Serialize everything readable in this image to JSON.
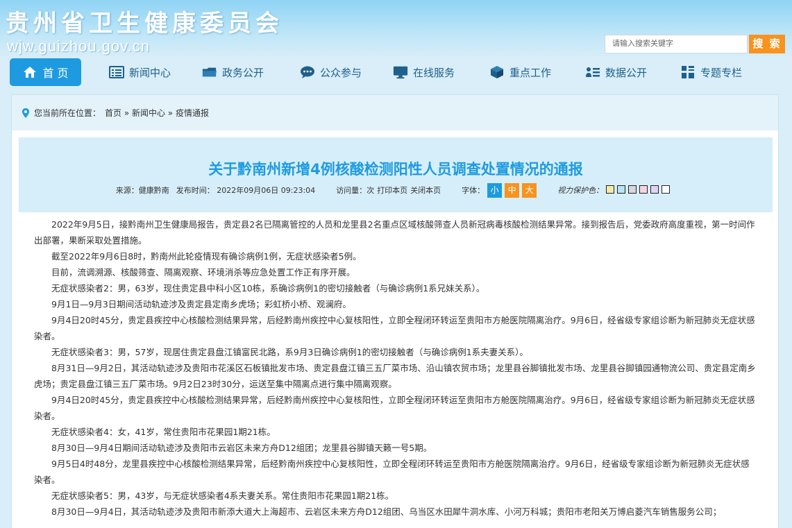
{
  "header": {
    "title": "贵州省卫生健康委员会",
    "domain": "wjw.guizhou.gov.cn",
    "search_placeholder": "请输入搜索关键字",
    "search_button": "搜 索"
  },
  "nav": {
    "items": [
      {
        "label": "首 页",
        "icon": "home-icon"
      },
      {
        "label": "新闻中心",
        "icon": "news-icon"
      },
      {
        "label": "政务公开",
        "icon": "folder-icon"
      },
      {
        "label": "公众参与",
        "icon": "chat-icon"
      },
      {
        "label": "在线服务",
        "icon": "monitor-icon"
      },
      {
        "label": "重点工作",
        "icon": "cube-icon"
      },
      {
        "label": "数据公开",
        "icon": "data-icon"
      },
      {
        "label": "专题专栏",
        "icon": "grid-icon"
      }
    ]
  },
  "breadcrumb": {
    "prefix": "您当前所在位置：",
    "path": "首页 » 新闻中心 » 疫情通报"
  },
  "article": {
    "title": "关于黔南州新增4例核酸检测阳性人员调查处置情况的通报",
    "source": "来源：健康黔南",
    "publish": "发布时间： 2022年09月06日 09:23:04",
    "visits": "访问量：次",
    "print": "打印本页",
    "close": "关闭本页",
    "font_label": "字体：",
    "font_small": "小",
    "font_mid": "中",
    "font_big": "大",
    "eye_label": "视力保护色：",
    "eye_colors": [
      "#f5e9a8",
      "#b9e3f0",
      "#d8d8d8",
      "#f7d4dc",
      "#e3d4f3",
      "#ffffff"
    ],
    "paragraphs": [
      "2022年9月5日，接黔南州卫生健康局报告，贵定县2名已隔离管控的人员和龙里县2名重点区域核酸筛查人员新冠病毒核酸检测结果异常。接到报告后，党委政府高度重视，第一时间作出部署，果断采取处置措施。",
      "截至2022年9月6日8时，黔南州此轮疫情现有确诊病例1例，无症状感染者5例。",
      "目前，流调溯源、核酸筛查、隔离观察、环境消杀等应急处置工作正有序开展。",
      "无症状感染者2：男，63岁，现住贵定县中科小区10栋，系确诊病例1的密切接触者（与确诊病例1系兄妹关系）。",
      "9月1日—9月3日期间活动轨迹涉及贵定县定南乡虎场；彩虹桥小桥、观澜府。",
      "9月4日20时45分，贵定县疾控中心核酸检测结果异常，后经黔南州疾控中心复核阳性，立即全程闭环转运至贵阳市方舱医院隔离治疗。9月6日，经省级专家组诊断为新冠肺炎无症状感染者。",
      "无症状感染者3：男，57岁，现居住贵定县盘江镇富民北路，系9月3日确诊病例1的密切接触者（与确诊病例1系夫妻关系）。",
      "8月31日—9月2日，其活动轨迹涉及贵阳市花溪区石板镇批发市场、贵定县盘江镇三五厂菜市场、沿山镇农贸市场；龙里县谷脚镇批发市场、龙里县谷脚镇园通物流公司、贵定县定南乡虎场；贵定县盘江镇三五厂菜市场。9月2日23时30分，运送至集中隔离点进行集中隔离观察。",
      "9月4日20时45分，贵定县疾控中心核酸检测结果异常，后经黔南州疾控中心复核阳性，立即全程闭环转运至贵阳市方舱医院隔离治疗。9月6日，经省级专家组诊断为新冠肺炎无症状感染者。",
      " 无症状感染者4：女，41岁，常住贵阳市花果园1期21栋。",
      "8月30日—9月4日期间活动轨迹涉及贵阳市云岩区未来方舟D12组团；龙里县谷脚镇天籁一号5期。",
      "9月5日4时48分，龙里县疾控中心核酸检测结果异常，后经黔南州疾控中心复核阳性，立即全程闭环转运至贵阳市方舱医院隔离治疗。9月6日，经省级专家组诊断为新冠肺炎无症状感染者。",
      "无症状感染者5：男，43岁，与无症状感染者4系夫妻关系。常住贵阳市花果园1期21栋。",
      "8月30日—9月4日，其活动轨迹涉及贵阳市新添大道大上海超市、云岩区未来方舟D12组团、乌当区水田犀牛洞水库、小河万科城；贵阳市老阳关万博启菱汽车销售服务公司；"
    ]
  }
}
